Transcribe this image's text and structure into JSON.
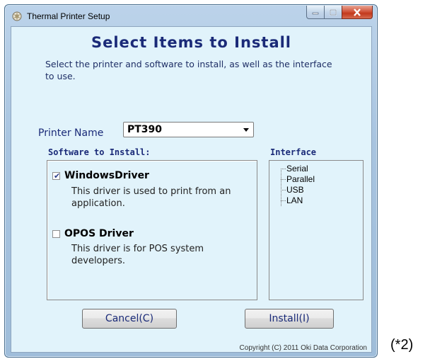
{
  "window": {
    "title": "Thermal Printer Setup"
  },
  "content": {
    "heading": "Select Items to Install",
    "description": "Select the printer and software to install, as well as the interface to use."
  },
  "printer": {
    "label": "Printer Name",
    "selected": "PT390"
  },
  "software": {
    "label": "Software to Install:",
    "items": [
      {
        "name": "WindowsDriver",
        "checked": true,
        "description": "This driver is used to print from an application."
      },
      {
        "name": "OPOS Driver",
        "checked": false,
        "description": "This driver is for POS system developers."
      }
    ]
  },
  "interface": {
    "label": "Interface",
    "items": [
      "Serial",
      "Parallel",
      "USB",
      "LAN"
    ]
  },
  "buttons": {
    "cancel": "Cancel(C)",
    "install": "Install(I)"
  },
  "copyright": "Copyright (C) 2011 Oki Data Corporation",
  "note": "(*2)"
}
